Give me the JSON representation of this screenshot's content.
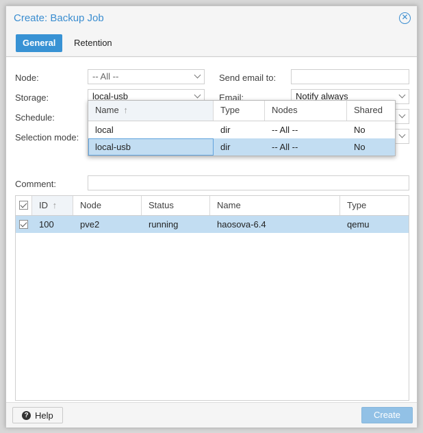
{
  "window": {
    "title": "Create: Backup Job"
  },
  "tabs": [
    {
      "label": "General",
      "active": true
    },
    {
      "label": "Retention",
      "active": false
    }
  ],
  "form": {
    "node_label": "Node:",
    "node_value": "-- All --",
    "storage_label": "Storage:",
    "storage_value": "local-usb",
    "schedule_label": "Schedule:",
    "selection_mode_label": "Selection mode:",
    "send_email_label": "Send email to:",
    "send_email_value": "",
    "email_label": "Email:",
    "email_value": "Notify always",
    "comment_label": "Comment:",
    "comment_value": ""
  },
  "storage_dropdown": {
    "columns": [
      "Name",
      "Type",
      "Nodes",
      "Shared"
    ],
    "sort_arrow": "↑",
    "rows": [
      {
        "name": "local",
        "type": "dir",
        "nodes": "-- All --",
        "shared": "No",
        "selected": false
      },
      {
        "name": "local-usb",
        "type": "dir",
        "nodes": "-- All --",
        "shared": "No",
        "selected": true
      }
    ]
  },
  "guest_grid": {
    "columns": [
      "ID",
      "Node",
      "Status",
      "Name",
      "Type"
    ],
    "sort_arrow": "↑",
    "rows": [
      {
        "id": "100",
        "node": "pve2",
        "status": "running",
        "name": "haosova-6.4",
        "type": "qemu",
        "checked": true
      }
    ]
  },
  "footer": {
    "help_label": "Help",
    "create_label": "Create"
  },
  "colors": {
    "accent": "#3892d4",
    "title": "#3a8dd0",
    "selected_row": "#c2ddf2",
    "create_disabled": "#92c1e6"
  },
  "icons": {
    "close": "close-icon",
    "help": "help-icon",
    "chevron": "chevron-down-icon",
    "sort": "sort-up-icon",
    "checkbox": "checkbox-checked-icon"
  }
}
